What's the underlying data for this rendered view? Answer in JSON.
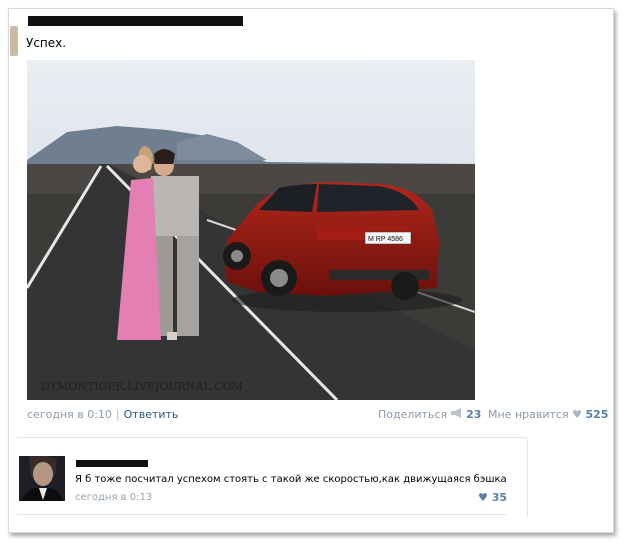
{
  "post": {
    "text": "Успех.",
    "photo_watermark": "DYMONTIGER.LIVEJOURNAL.COM",
    "car_plate": "M RP 4586",
    "timestamp": "сегодня в 0:10",
    "separator": "|",
    "reply_label": "Ответить",
    "share_label": "Поделиться",
    "share_count": "23",
    "like_label": "Мне нравится",
    "like_count": "525"
  },
  "comment": {
    "text": "Я б тоже посчитал успехом стоять с такой же скоростью,как движущаяся бэшка",
    "timestamp": "сегодня в 0:13",
    "like_count": "35"
  },
  "colors": {
    "link": "#2b587a",
    "meta": "#8c9aa8",
    "count": "#5b7fa6"
  },
  "icons": {
    "share": "megaphone-icon",
    "like": "heart-icon"
  }
}
